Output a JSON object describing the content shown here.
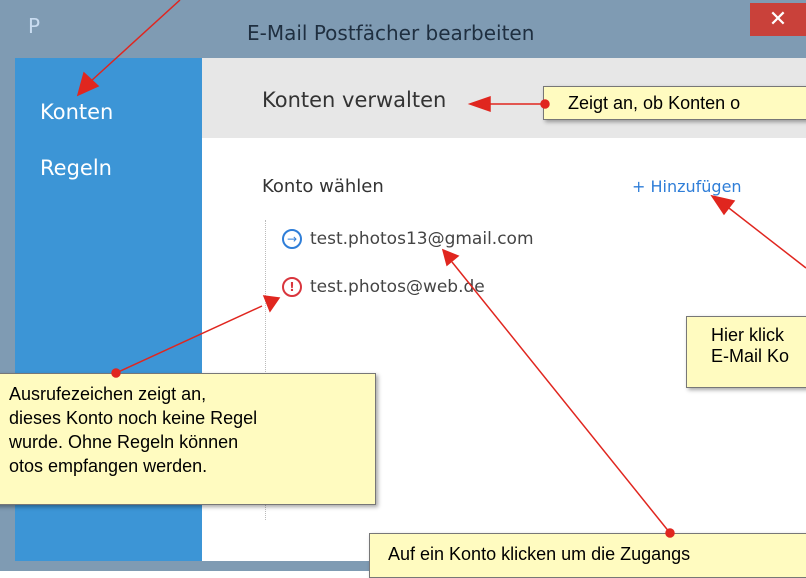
{
  "window": {
    "title": "E-Mail Postfächer bearbeiten",
    "app_logo": "P",
    "close_label": "✕"
  },
  "sidebar": {
    "items": [
      {
        "label": "Konten"
      },
      {
        "label": "Regeln"
      }
    ]
  },
  "content": {
    "section_title": "Konten verwalten",
    "choose_label": "Konto wählen",
    "add_label": "+ Hinzufügen",
    "accounts": [
      {
        "email": "test.photos13@gmail.com",
        "icon": "arrow-right-circle-icon",
        "status": "ok"
      },
      {
        "email": "test.photos@web.de",
        "icon": "exclamation-circle-icon",
        "status": "warning"
      }
    ]
  },
  "callouts": {
    "header": "Zeigt an, ob Konten o",
    "add": {
      "line1": "Hier klick",
      "line2": "E-Mail Ko"
    },
    "warning": {
      "line1": "Ausrufezeichen zeigt an,",
      "line2": "dieses Konto noch keine Regel",
      "line3": "wurde. Ohne Regeln können",
      "line4": "otos empfangen werden."
    },
    "bottom": "Auf ein Konto klicken um die Zugangs"
  },
  "colors": {
    "sidebar": "#3c95d6",
    "window_frame": "#7f9bb3",
    "close": "#c9413a",
    "callout_bg": "#fffbc0",
    "arrow": "#e0261f"
  }
}
